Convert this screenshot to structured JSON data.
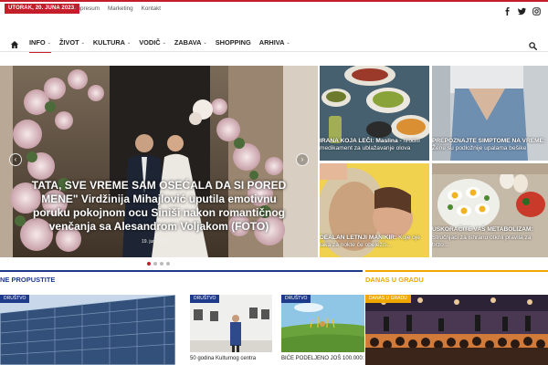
{
  "topbar": {
    "date": "UTORAK, 20. JUNA 2023.",
    "links": [
      "Impresum",
      "Marketing",
      "Kontakt"
    ],
    "social_icons": [
      "facebook-icon",
      "twitter-icon",
      "instagram-icon"
    ]
  },
  "nav": {
    "items": [
      {
        "label": "INFO",
        "has_dropdown": true,
        "active": true
      },
      {
        "label": "ŽIVOT",
        "has_dropdown": true
      },
      {
        "label": "KULTURA",
        "has_dropdown": true
      },
      {
        "label": "VODIČ",
        "has_dropdown": true
      },
      {
        "label": "ZABAVA",
        "has_dropdown": true
      },
      {
        "label": "SHOPPING",
        "has_dropdown": false
      },
      {
        "label": "ARHIVA",
        "has_dropdown": true
      }
    ],
    "caret": "⌄"
  },
  "hero": {
    "caption": "TATA, SVE VREME SAM OSEĆALA DA SI PORED MENE\" Virdžinija Mihajlović uputila emotivnu poruku pokojnom ocu Siniši nakon romantičnog venčanja sa Alesandrom Voljakom (FOTO)",
    "date": "19. jun 2023.",
    "dots": 4,
    "active_dot": 0,
    "prev": "‹",
    "next": "›"
  },
  "tiles": [
    {
      "caption_bold": "IRANA KOJA LEČI: Maslina -",
      "caption_rest": "rirodni medikament za ublažavanje olova"
    },
    {
      "caption_bold": "PREPOZNAJTE SIMPTOME NA VREME:",
      "caption_rest": "Žene su podložnije upalama bešike"
    },
    {
      "caption_bold": "DEALAN LETNJI MANIKIR:",
      "caption_rest": "Koje oje laka za nokte će obeležiti..."
    },
    {
      "caption_bold": "USKORAČITE VAŠ METABOLIZAM:",
      "caption_rest": "Stručnjaci za ishranu otkrili pravila za brzo..."
    }
  ],
  "sections": {
    "left_title": "NE PROPUSTITE",
    "right_title": "DANAS U GRADU",
    "left_color": "#1e3a8a",
    "right_color": "#f0a800"
  },
  "cards": [
    {
      "badge": "DRUŠTVO",
      "title": ""
    },
    {
      "badge": "DRUŠTVO",
      "title": "50 godina Kulturnog centra"
    },
    {
      "badge": "DRUŠTVO",
      "title": "BIĆE PODELJENO JOŠ 100.000:"
    },
    {
      "badge": "DANAS U GRADU",
      "title": ""
    }
  ],
  "colors": {
    "accent": "#c41e2a",
    "blue": "#1e3a8a",
    "yellow": "#f0a800"
  }
}
